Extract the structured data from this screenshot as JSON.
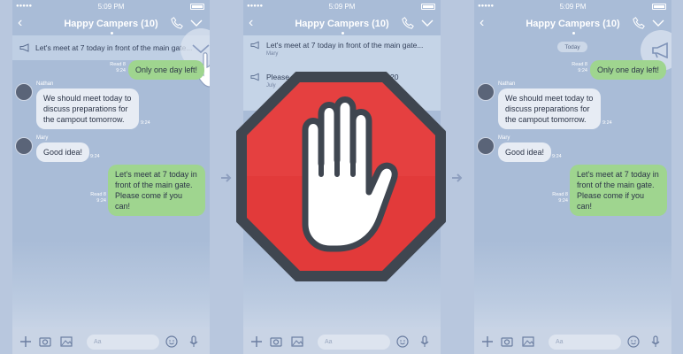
{
  "status_time": "5:09 PM",
  "chat_title": "Happy Campers (10)",
  "input_placeholder": "Aa",
  "panel1": {
    "announcement": "Let's meet at 7 today in front of the main gate...",
    "out1": {
      "text": "Only one day left!",
      "read": "Read 8",
      "time": "9:24"
    },
    "in1": {
      "sender": "Nathan",
      "text": "We should meet today to discuss preparations for the campout tomorrow.",
      "time": "9:24"
    },
    "in2": {
      "sender": "Mary",
      "text": "Good idea!",
      "time": "9:24"
    },
    "out2": {
      "text": "Let's meet at 7 today in front of the main gate. Please come if you can!",
      "read": "Read 8",
      "time": "9:24"
    }
  },
  "panel2": {
    "ann1": {
      "text": "Let's meet at 7 today in front of the main gate...",
      "author": "Mary"
    },
    "ann2": {
      "text": "Please",
      "suffix": "20",
      "author": "July"
    }
  },
  "panel3": {
    "today": "Today",
    "out1": {
      "text": "Only one day left!",
      "read": "Read 8",
      "time": "9:24"
    },
    "in1": {
      "sender": "Nathan",
      "text": "We should meet today to discuss preparations for the campout tomorrow.",
      "time": "9:24"
    },
    "in2": {
      "sender": "Mary",
      "text": "Good idea!",
      "time": "9:24"
    },
    "out2": {
      "text": "Let's meet at 7 today in front of the main gate. Please come if you can!",
      "read": "Read 8",
      "time": "9:24"
    }
  },
  "colors": {
    "stop_red": "#e23a3a",
    "stop_border": "#3f4650",
    "outgoing_bubble": "#9fd58f",
    "incoming_bubble": "#e7ecf4",
    "chat_background": "#a9bcd7"
  },
  "icons": [
    "back-icon",
    "phone-icon",
    "chevron-down-icon",
    "megaphone-icon",
    "plus-icon",
    "camera-icon",
    "image-icon",
    "emoji-icon",
    "microphone-icon",
    "hand-stop-icon",
    "arrow-right-icon",
    "pointing-hand-icon"
  ]
}
